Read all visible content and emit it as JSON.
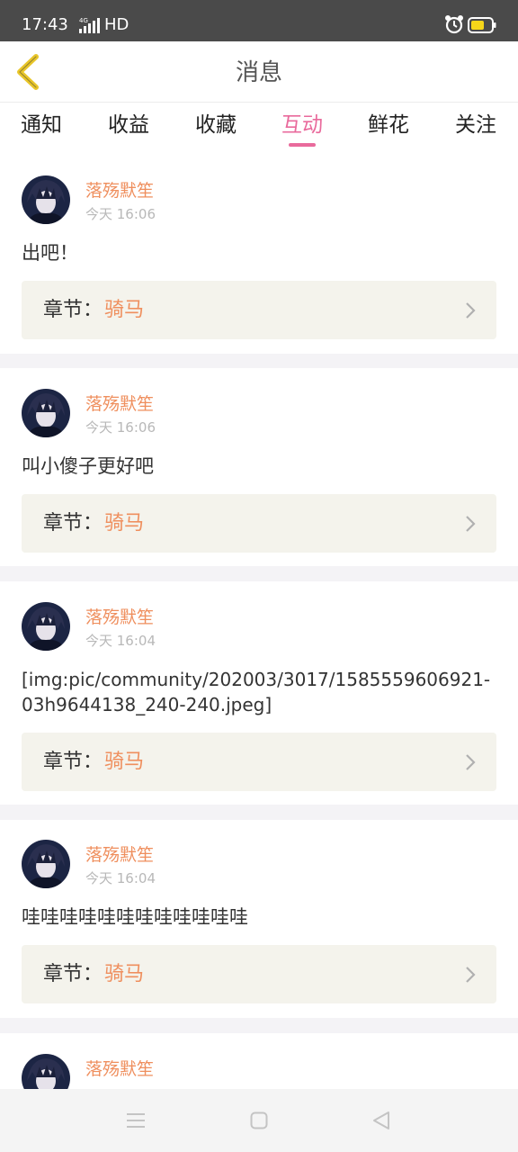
{
  "status_bar": {
    "time": "17:43",
    "network": "4G",
    "hd": "HD",
    "battery_color": "#f6d61a"
  },
  "header": {
    "title": "消息",
    "back_icon": "chevron-left-icon",
    "back_icon_color": "#e9c62a"
  },
  "tabs": [
    {
      "label": "通知",
      "active": false
    },
    {
      "label": "收益",
      "active": false
    },
    {
      "label": "收藏",
      "active": false
    },
    {
      "label": "互动",
      "active": true
    },
    {
      "label": "鲜花",
      "active": false
    },
    {
      "label": "关注",
      "active": false
    }
  ],
  "accent_color": "#e96a9c",
  "name_color": "#ef8f5e",
  "messages": [
    {
      "user": "落殇默笙",
      "time": "今天 16:06",
      "text": "出吧！",
      "chapter_label": "章节：",
      "chapter": "骑马"
    },
    {
      "user": "落殇默笙",
      "time": "今天 16:06",
      "text": "叫小傻子更好吧",
      "chapter_label": "章节：",
      "chapter": "骑马"
    },
    {
      "user": "落殇默笙",
      "time": "今天 16:04",
      "text": "[img:pic/community/202003/3017/1585559606921-03h9644138_240-240.jpeg]",
      "chapter_label": "章节：",
      "chapter": "骑马"
    },
    {
      "user": "落殇默笙",
      "time": "今天 16:04",
      "text": "哇哇哇哇哇哇哇哇哇哇哇哇",
      "chapter_label": "章节：",
      "chapter": "骑马"
    },
    {
      "user": "落殇默笙",
      "time": "",
      "text": "",
      "chapter_label": "",
      "chapter": ""
    }
  ],
  "nav_bar": {
    "icons": [
      "menu-icon",
      "home-icon",
      "back-triangle-icon"
    ]
  }
}
